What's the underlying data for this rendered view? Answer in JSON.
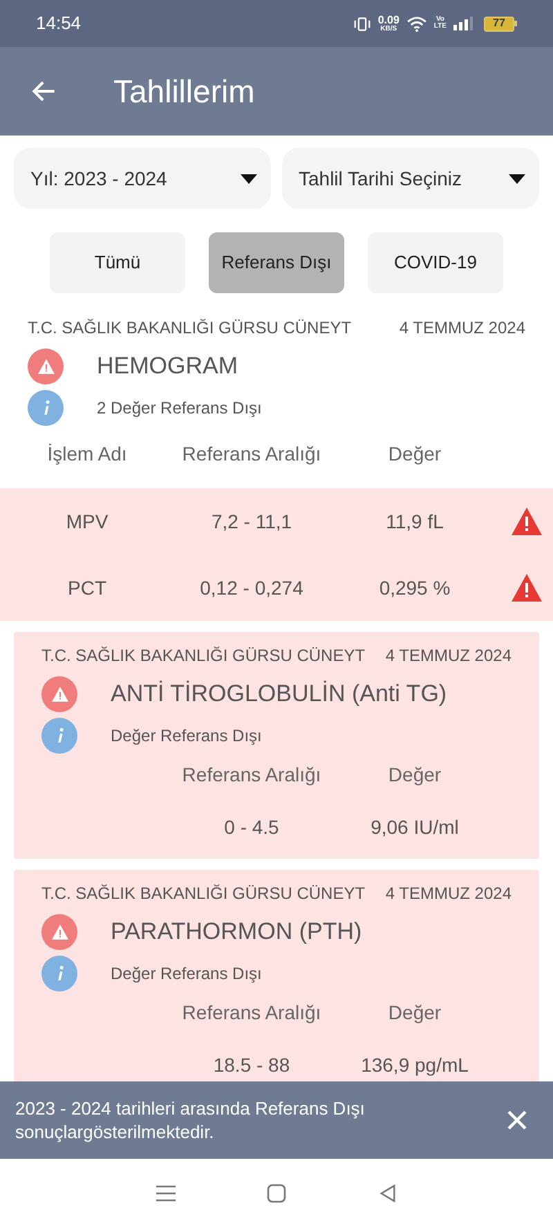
{
  "status_bar": {
    "time": "14:54",
    "net_speed": "0.09",
    "net_unit": "KB/S",
    "volte": "Vo",
    "lte": "LTE",
    "battery": "77"
  },
  "header": {
    "title": "Tahlillerim"
  },
  "filters": [
    {
      "value": "Yıl: 2023 - 2024"
    },
    {
      "value": "Tahlil Tarihi Seçiniz"
    }
  ],
  "tabs": [
    {
      "label": "Tümü",
      "selected": false
    },
    {
      "label": "Referans Dışı",
      "selected": true
    },
    {
      "label": "COVID-19",
      "selected": false
    }
  ],
  "results": [
    {
      "highlighted": false,
      "source": "T.C. SAĞLIK BAKANLIĞI GÜRSU CÜNEYT",
      "date": "4 TEMMUZ 2024",
      "name": "HEMOGRAM",
      "summary": "2 Değer Referans Dışı",
      "columns": [
        "İşlem Adı",
        "Referans Aralığı",
        "Değer"
      ],
      "rows": [
        {
          "alert": true,
          "cells": [
            "MPV",
            "7,2 - 11,1",
            "11,9 fL"
          ]
        },
        {
          "alert": true,
          "cells": [
            "PCT",
            "0,12 - 0,274",
            "0,295 %"
          ]
        }
      ]
    },
    {
      "highlighted": true,
      "source": "T.C. SAĞLIK BAKANLIĞI GÜRSU CÜNEYT",
      "date": "4 TEMMUZ 2024",
      "name": "ANTİ TİROGLOBULİN (Anti TG)",
      "summary": "Değer Referans Dışı",
      "columns": [
        "Referans Aralığı",
        "Değer"
      ],
      "rows": [
        {
          "alert": false,
          "cells": [
            "0 - 4.5",
            "9,06 IU/ml"
          ]
        }
      ]
    },
    {
      "highlighted": true,
      "source": "T.C. SAĞLIK BAKANLIĞI GÜRSU CÜNEYT",
      "date": "4 TEMMUZ 2024",
      "name": "PARATHORMON (PTH)",
      "summary": "Değer Referans Dışı",
      "columns": [
        "Referans Aralığı",
        "Değer"
      ],
      "rows": [
        {
          "alert": false,
          "cells": [
            "18.5 - 88",
            "136,9 pg/mL"
          ]
        }
      ]
    }
  ],
  "snackbar": {
    "message": "2023 - 2024 tarihleri arasında Referans Dışı sonuçlargösterilmektedir."
  }
}
